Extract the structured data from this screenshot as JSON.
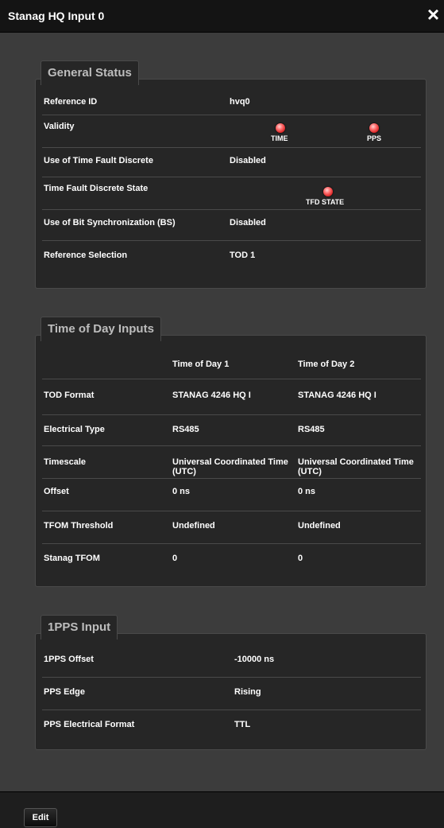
{
  "window": {
    "title": "Stanag HQ Input 0",
    "close_label": "×"
  },
  "general_status": {
    "legend": "General Status",
    "rows": [
      {
        "label": "Reference ID",
        "value": "hvq0"
      },
      {
        "label": "Validity",
        "leds": [
          {
            "caption": "TIME",
            "color": "#ff3b3b"
          },
          {
            "caption": "PPS",
            "color": "#ff3b3b"
          }
        ]
      },
      {
        "label": "Use of Time Fault Discrete",
        "value": "Disabled"
      },
      {
        "label": "Time Fault Discrete State",
        "leds": [
          {
            "caption": "TFD STATE",
            "color": "#ff3b3b"
          }
        ]
      },
      {
        "label": "Use of Bit Synchronization (BS)",
        "value": "Disabled"
      },
      {
        "label": "Reference Selection",
        "value": "TOD 1"
      }
    ]
  },
  "tod_inputs": {
    "legend": "Time of Day Inputs",
    "columns": [
      "",
      "Time of Day 1",
      "Time of Day 2"
    ],
    "rows": [
      {
        "label": "TOD Format",
        "v1": "STANAG 4246 HQ I",
        "v2": "STANAG 4246 HQ I"
      },
      {
        "label": "Electrical Type",
        "v1": "RS485",
        "v2": "RS485"
      },
      {
        "label": "Timescale",
        "v1": "Universal Coordinated Time (UTC)",
        "v2": "Universal Coordinated Time (UTC)"
      },
      {
        "label": "Offset",
        "v1": "0 ns",
        "v2": "0 ns"
      },
      {
        "label": "TFOM Threshold",
        "v1": "Undefined",
        "v2": "Undefined"
      },
      {
        "label": "Stanag TFOM",
        "v1": "0",
        "v2": "0"
      }
    ]
  },
  "pps_input": {
    "legend": "1PPS Input",
    "rows": [
      {
        "label": "1PPS Offset",
        "value": "-10000 ns"
      },
      {
        "label": "PPS Edge",
        "value": "Rising"
      },
      {
        "label": "PPS Electrical Format",
        "value": "TTL"
      }
    ]
  },
  "footer": {
    "edit_label": "Edit"
  }
}
